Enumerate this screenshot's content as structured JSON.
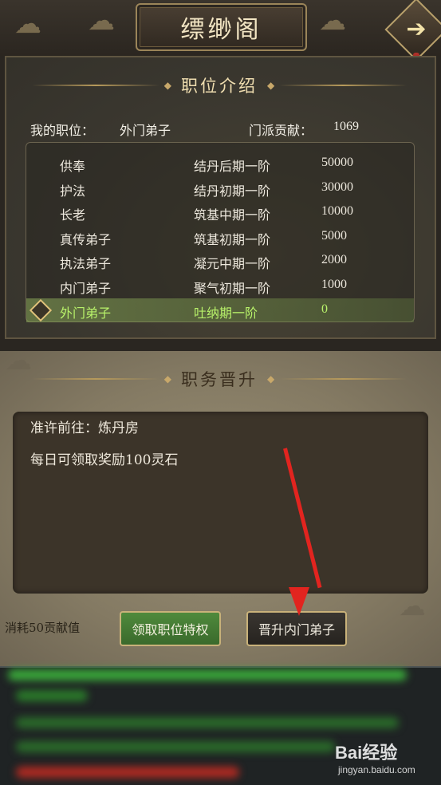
{
  "header": {
    "title": "缥缈阁",
    "next_icon": "arrow-right-icon"
  },
  "position_intro": {
    "section_title": "职位介绍",
    "my_position_label": "我的职位：",
    "my_position_value": "外门弟子",
    "contribution_label": "门派贡献：",
    "contribution_value": "1069",
    "ranks": [
      {
        "name": "供奉",
        "requirement": "结丹后期一阶",
        "contribution": "50000"
      },
      {
        "name": "护法",
        "requirement": "结丹初期一阶",
        "contribution": "30000"
      },
      {
        "name": "长老",
        "requirement": "筑基中期一阶",
        "contribution": "10000"
      },
      {
        "name": "真传弟子",
        "requirement": "筑基初期一阶",
        "contribution": "5000"
      },
      {
        "name": "执法弟子",
        "requirement": "凝元中期一阶",
        "contribution": "2000"
      },
      {
        "name": "内门弟子",
        "requirement": "聚气初期一阶",
        "contribution": "1000"
      },
      {
        "name": "外门弟子",
        "requirement": "吐纳期一阶",
        "contribution": "0"
      }
    ]
  },
  "promotion": {
    "section_title": "职务晋升",
    "description_lines": [
      "准许前往：炼丹房",
      "每日可领取奖励100灵石"
    ],
    "cost_text": "消耗50贡献值",
    "claim_button": "领取职位特权",
    "promote_button": "晋升内门弟子"
  },
  "watermark": {
    "brand": "Bai经验",
    "url": "jingyan.baidu.com"
  },
  "colors": {
    "selected_row_text": "#b8f26a",
    "green_button": "#4f8a3c",
    "annotation_arrow": "#e2241f"
  }
}
